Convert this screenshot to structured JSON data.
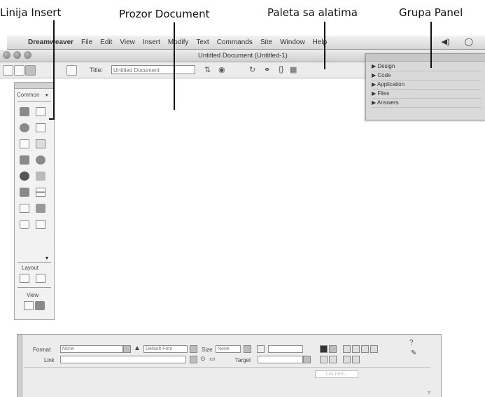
{
  "callouts": {
    "insert_bar": "Linija Insert",
    "document_window": "Prozor Document",
    "toolbar": "Paleta sa alatima",
    "panel_group": "Grupa Panel"
  },
  "menubar": {
    "apple": "",
    "app_name": "Dreamweaver",
    "items": [
      "File",
      "Edit",
      "View",
      "Insert",
      "Modify",
      "Text",
      "Commands",
      "Site",
      "Window",
      "Help"
    ],
    "status_icons": [
      "◀)",
      "◯"
    ]
  },
  "document": {
    "window_title": "Untitled Document (Untitled-1)",
    "title_label": "Title:",
    "title_value": "Untitled Document"
  },
  "panel_group": {
    "panels": [
      "▶ Design",
      "▶ Code",
      "▶ Application",
      "▶ Files",
      "▶ Answers"
    ]
  },
  "insert_bar": {
    "category": "Common",
    "layout_label": "Layout",
    "view_label": "View"
  },
  "properties": {
    "format_label": "Format",
    "format_value": "None",
    "font_value": "Default Font",
    "size_label": "Size",
    "size_value": "None",
    "link_label": "Link",
    "target_label": "Target",
    "list_item_button": "List Item..."
  }
}
